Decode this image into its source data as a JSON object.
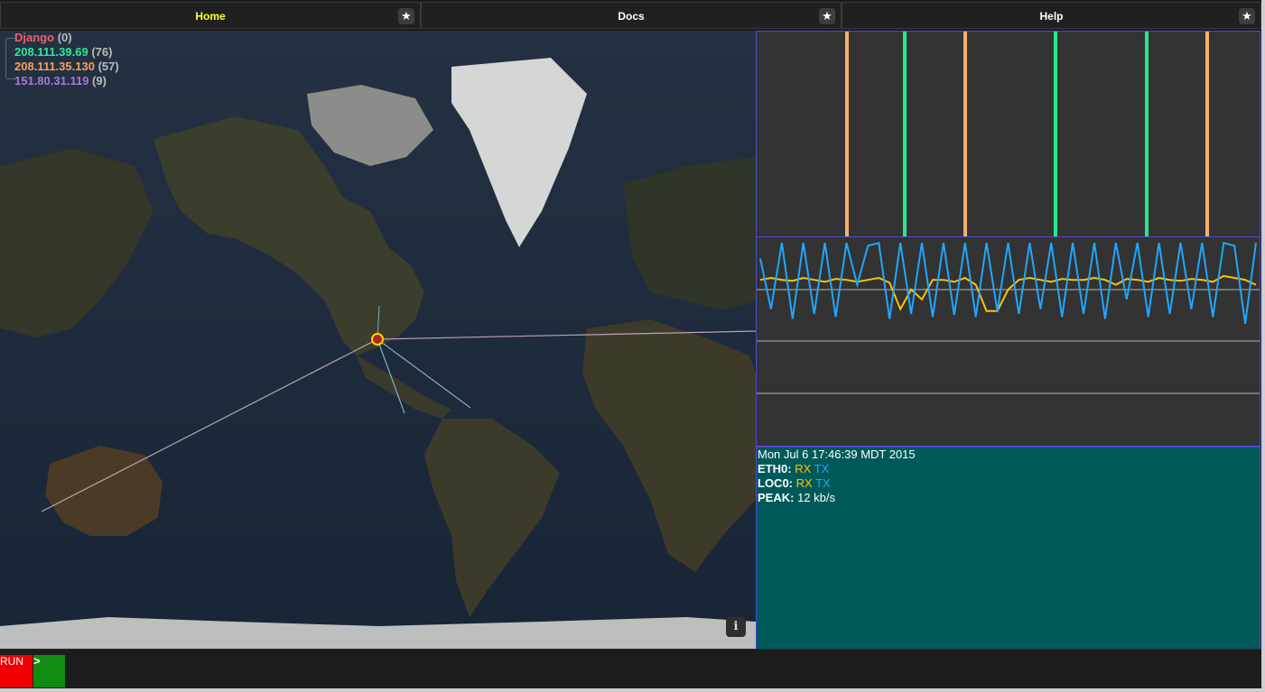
{
  "tabs": [
    {
      "label": "Home",
      "active": true
    },
    {
      "label": "Docs",
      "active": false
    },
    {
      "label": "Help",
      "active": false
    }
  ],
  "tab_star_glyph": "★",
  "map": {
    "legend": [
      {
        "label": "Django",
        "count": "(0)",
        "color": "#e8606c"
      },
      {
        "label": "208.111.39.69",
        "count": "(76)",
        "color": "#2fe5a0"
      },
      {
        "label": "208.111.35.130",
        "count": "(57)",
        "color": "#f4a25a"
      },
      {
        "label": "151.80.31.119",
        "count": "(9)",
        "color": "#a27bd9"
      }
    ],
    "info_label": "i",
    "colors": {
      "ocean": "#1d2b3c",
      "land": "#3a3b2a",
      "ice": "#d8d8d8",
      "node": "#ffd400",
      "node_core": "#b3261e",
      "link": "#b9a3b3"
    }
  },
  "bar_chart": {
    "colors": {
      "orange": "#f7b06a",
      "green": "#27e88f",
      "border": "#4b4bd6"
    },
    "bars": [
      {
        "color": "orange",
        "x": 0.18
      },
      {
        "color": "green",
        "x": 0.295
      },
      {
        "color": "orange",
        "x": 0.415
      },
      {
        "color": "green",
        "x": 0.595
      },
      {
        "color": "green",
        "x": 0.775
      },
      {
        "color": "orange",
        "x": 0.895
      }
    ]
  },
  "line_chart": {
    "rx_color": "#ffc400",
    "tx_color": "#1fa7ff",
    "tx": [
      0.82,
      0.3,
      0.98,
      0.2,
      0.98,
      0.25,
      0.98,
      0.22,
      0.98,
      0.55,
      0.95,
      0.98,
      0.2,
      0.98,
      0.25,
      0.98,
      0.22,
      0.98,
      0.24,
      0.98,
      0.22,
      0.98,
      0.28,
      0.98,
      0.25,
      0.98,
      0.3,
      0.98,
      0.22,
      0.98,
      0.25,
      0.98,
      0.2,
      0.98,
      0.4,
      0.98,
      0.22,
      0.98,
      0.25,
      0.98,
      0.3,
      0.98,
      0.22,
      0.98,
      0.95,
      0.15,
      0.98
    ],
    "rx": [
      0.6,
      0.62,
      0.6,
      0.59,
      0.62,
      0.6,
      0.58,
      0.61,
      0.6,
      0.58,
      0.6,
      0.62,
      0.57,
      0.3,
      0.5,
      0.4,
      0.6,
      0.6,
      0.58,
      0.62,
      0.55,
      0.28,
      0.28,
      0.5,
      0.6,
      0.62,
      0.6,
      0.58,
      0.61,
      0.6,
      0.6,
      0.62,
      0.6,
      0.55,
      0.61,
      0.6,
      0.58,
      0.62,
      0.6,
      0.59,
      0.61,
      0.6,
      0.58,
      0.64,
      0.62,
      0.6,
      0.55
    ]
  },
  "status": {
    "datetime": "Mon Jul 6 17:46:39 MDT 2015",
    "eth0_label": "ETH0:",
    "loc0_label": "LOC0:",
    "peak_label": "PEAK:",
    "rx_text": "RX",
    "tx_text": "TX",
    "peak_value": "12 kb/s"
  },
  "bottom": {
    "run_label": "RUN",
    "go_label": ">"
  }
}
